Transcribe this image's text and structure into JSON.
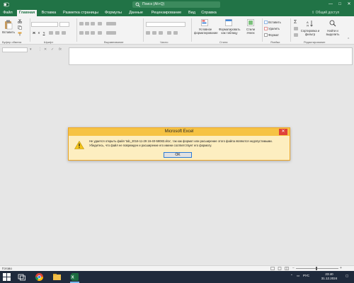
{
  "window": {
    "title": "Excel",
    "search_placeholder": "Поиск (Alt+Q)",
    "minimize_symbol": "—",
    "maximize_symbol": "□",
    "close_symbol": "✕"
  },
  "tabs": [
    "Файл",
    "Главная",
    "Вставка",
    "Разметка страницы",
    "Формулы",
    "Данные",
    "Рецензирование",
    "Вид",
    "Справка"
  ],
  "active_tab": "Главная",
  "share_label": "Общий доступ",
  "ribbon": {
    "groups": {
      "clipboard": "Буфер обмена",
      "font": "Шрифт",
      "alignment": "Выравнивание",
      "number": "Число",
      "styles": "Стили",
      "cells": "Ячейки",
      "editing": "Редактирование"
    },
    "paste_label": "Вставить",
    "bold": "Ж",
    "italic": "К",
    "underline": "Ч",
    "cond_format_label": "Условное форматирование",
    "format_table_label": "Форматировать как таблицу",
    "cell_styles_label": "Стили ячеек",
    "insert_label": "Вставить",
    "delete_label": "Удалить",
    "format_label": "Формат",
    "sort_filter_label": "Сортировка и фильтр",
    "find_select_label": "Найти и выделить"
  },
  "formula_bar": {
    "fx": "fx",
    "cancel": "✕",
    "enter": "✓"
  },
  "dialog": {
    "title": "Microsoft Excel",
    "close_symbol": "✕",
    "message": "Не удается открыть файл 'tab_2016-11-29 16-40-59083.xlsx', так как формат или расширение этого файла являются недопустимыми. Убедитесь, что файл не поврежден и расширение его имени соответствует его формату.",
    "ok_label": "OK"
  },
  "status": {
    "ready": "Готово"
  },
  "taskbar": {
    "language": "РУС",
    "time": "23:40",
    "date": "31.12.2024"
  },
  "colors": {
    "excel_green": "#217346",
    "dialog_title": "#f6c344",
    "dialog_body": "#fdeec0",
    "taskbar": "#1f2a3c"
  }
}
